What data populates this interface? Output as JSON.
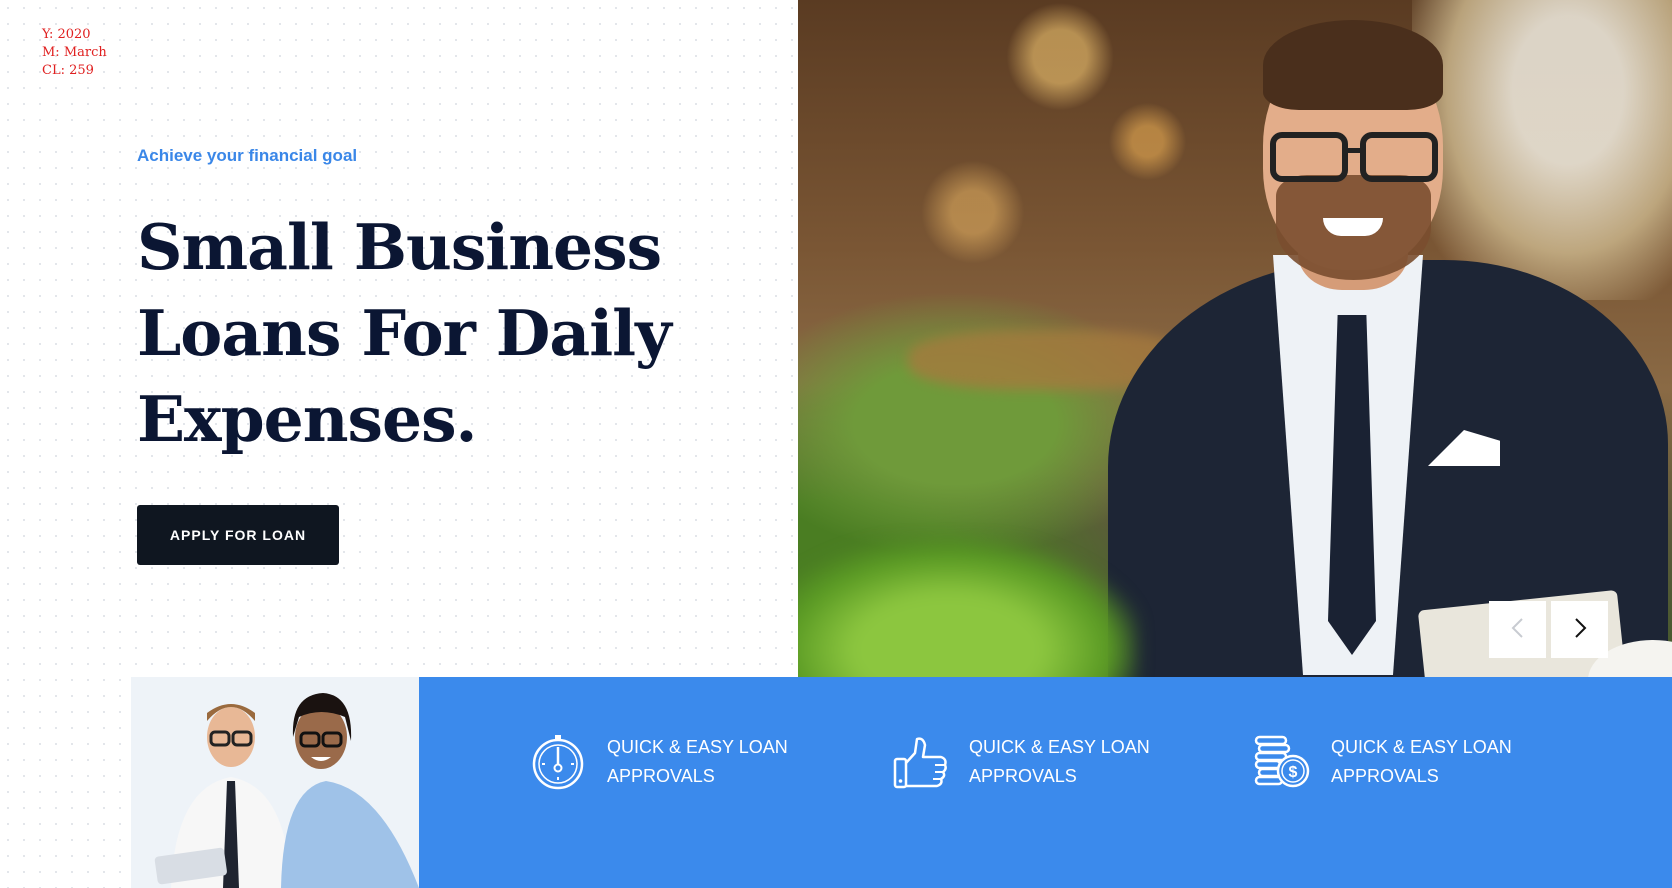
{
  "meta": {
    "year": "Y: 2020",
    "month": "M: March",
    "cl": "CL: 259"
  },
  "hero": {
    "eyebrow": "Achieve your financial goal",
    "headline": "Small Business Loans For Daily Expenses.",
    "cta_label": "APPLY FOR LOAN"
  },
  "carousel": {
    "prev_icon": "chevron-left-icon",
    "next_icon": "chevron-right-icon"
  },
  "features": [
    {
      "icon": "stopwatch-icon",
      "text": "QUICK & EASY LOAN APPROVALS"
    },
    {
      "icon": "thumbs-up-icon",
      "text": "QUICK & EASY LOAN APPROVALS"
    },
    {
      "icon": "coins-dollar-icon",
      "text": "QUICK & EASY LOAN APPROVALS"
    }
  ],
  "colors": {
    "accent": "#3b8aec",
    "heading": "#0b1633",
    "button": "#0f1620",
    "meta": "#e02020"
  }
}
